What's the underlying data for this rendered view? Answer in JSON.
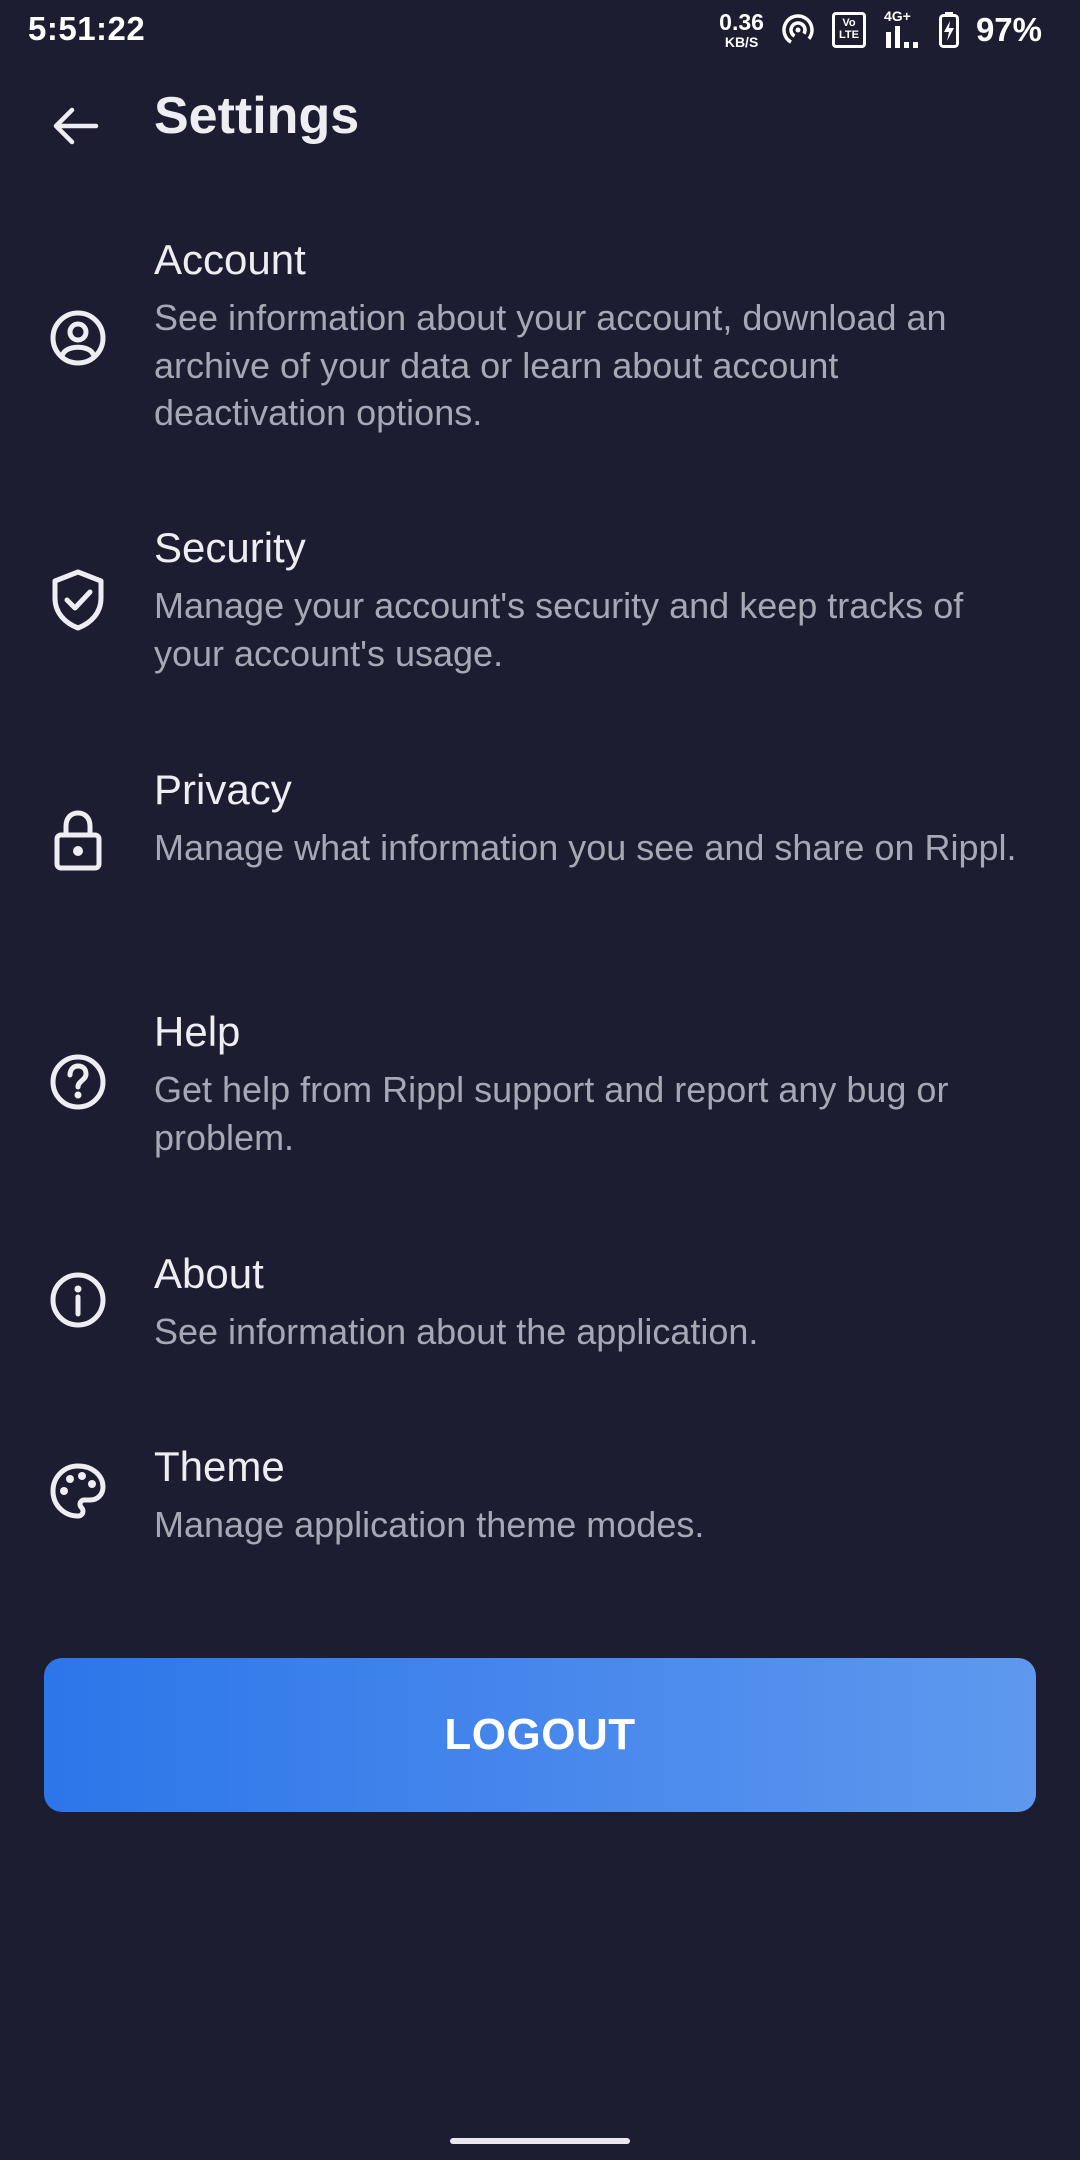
{
  "status_bar": {
    "time": "5:51:22",
    "net_speed_value": "0.36",
    "net_speed_unit": "KB/S",
    "volte_top": "Vo",
    "volte_bottom": "LTE",
    "network_type": "4G+",
    "battery_percent": "97%",
    "icons": [
      "hotspot-icon",
      "volte-icon",
      "signal-icon",
      "battery-charging-icon"
    ]
  },
  "header": {
    "back_icon": "arrow-left-icon",
    "title": "Settings"
  },
  "settings": {
    "items": [
      {
        "key": "account",
        "icon": "account-circle-icon",
        "title": "Account",
        "description": "See information about your account, download an archive of your data or learn about account deactivation options."
      },
      {
        "key": "security",
        "icon": "shield-check-icon",
        "title": "Security",
        "description": "Manage your account's security and keep tracks of your account's usage."
      },
      {
        "key": "privacy",
        "icon": "lock-icon",
        "title": "Privacy",
        "description": "Manage what information you see and share on Rippl."
      },
      {
        "key": "help",
        "icon": "help-circle-icon",
        "title": "Help",
        "description": "Get help from Rippl support and report any bug or problem."
      },
      {
        "key": "about",
        "icon": "info-circle-icon",
        "title": "About",
        "description": "See information about the application."
      },
      {
        "key": "theme",
        "icon": "palette-icon",
        "title": "Theme",
        "description": "Manage application theme modes."
      }
    ]
  },
  "logout": {
    "label": "LOGOUT",
    "gradient": [
      "#2b76ea",
      "#5e99ee"
    ]
  },
  "colors": {
    "background": "#1c1d31",
    "title_text": "#ededf2",
    "description_text": "#a7a8b5",
    "accent": "#3f82ec"
  }
}
